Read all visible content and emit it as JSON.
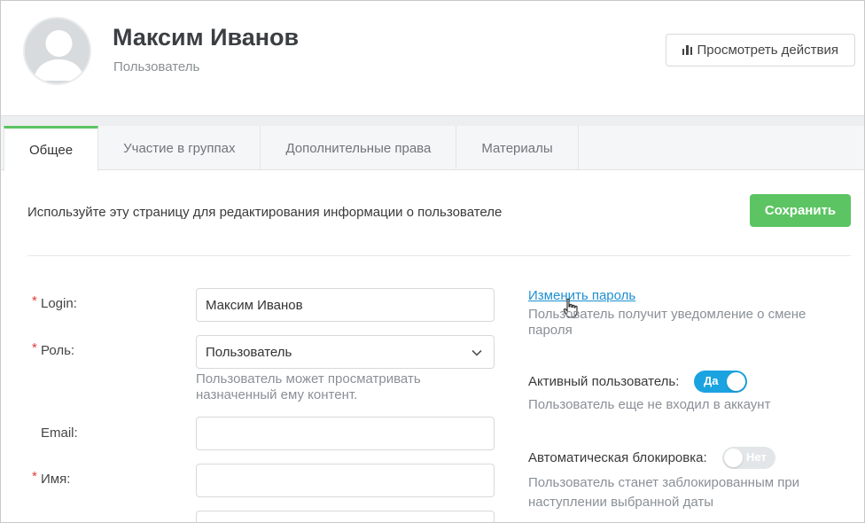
{
  "header": {
    "user_name": "Максим Иванов",
    "user_role": "Пользователь",
    "actions_button": "Просмотреть действия"
  },
  "tabs": [
    {
      "label": "Общее",
      "active": true
    },
    {
      "label": "Участие в группах",
      "active": false
    },
    {
      "label": "Дополнительные права",
      "active": false
    },
    {
      "label": "Материалы",
      "active": false
    }
  ],
  "content": {
    "intro": "Используйте эту страницу для редактирования информации о пользователе",
    "save_button": "Сохранить"
  },
  "form": {
    "login": {
      "label": "Login:",
      "value": "Максим Иванов",
      "required": true
    },
    "role": {
      "label": "Роль:",
      "value": "Пользователь",
      "required": true,
      "hint": "Пользователь может просматривать назначенный ему контент."
    },
    "email": {
      "label": "Email:",
      "value": "",
      "required": false
    },
    "first_name": {
      "label": "Имя:",
      "value": "",
      "required": true
    }
  },
  "side": {
    "change_password": "Изменить пароль",
    "change_password_hint": "Пользователь получит уведомление о смене пароля",
    "active_user_label": "Активный пользователь:",
    "active_user_toggle": "Да",
    "active_user_hint": "Пользователь еще не входил в аккаунт",
    "auto_block_label": "Автоматическая блокировка:",
    "auto_block_toggle": "Нет",
    "auto_block_hint": "Пользователь станет заблокированным при наступлении выбранной даты"
  },
  "colors": {
    "accent_green": "#5cc462",
    "toggle_on": "#1aa3e0",
    "link": "#1f8fd1",
    "required": "#e23b3b"
  }
}
